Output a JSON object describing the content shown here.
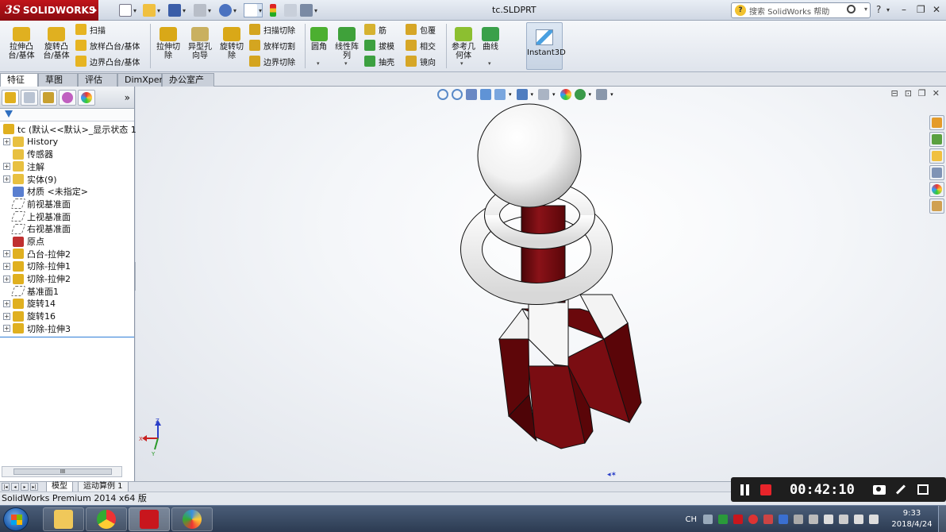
{
  "titlebar": {
    "logo_ds": "3S",
    "logo_text": "SOLIDWORKS",
    "doc_title": "tc.SLDPRT",
    "search_placeholder": "搜索 SolidWorks 帮助",
    "help": "?",
    "win_min": "–",
    "win_restore": "❐",
    "win_close": "✕"
  },
  "ribbon": {
    "big_buttons": [
      {
        "label": "拉伸凸\n台/基体",
        "icon": "extruded-boss-icon",
        "color": "#e0b020"
      },
      {
        "label": "旋转凸\n台/基体",
        "icon": "revolved-boss-icon",
        "color": "#e0b020"
      },
      {
        "label": "拉伸切\n除",
        "icon": "extruded-cut-icon",
        "color": "#d9a818"
      },
      {
        "label": "异型孔\n向导",
        "icon": "hole-wizard-icon",
        "color": "#c9b060"
      },
      {
        "label": "旋转切\n除",
        "icon": "revolved-cut-icon",
        "color": "#d9a818"
      },
      {
        "label": "圆角",
        "icon": "fillet-icon",
        "color": "#4caf30"
      },
      {
        "label": "线性阵\n列",
        "icon": "linear-pattern-icon",
        "color": "#3fa13a"
      },
      {
        "label": "参考几\n何体",
        "icon": "reference-geometry-icon",
        "color": "#8cbf30"
      },
      {
        "label": "曲线",
        "icon": "curves-icon",
        "color": "#3aa04a"
      }
    ],
    "small_buttons": [
      {
        "label": "扫描",
        "icon": "sweep-icon",
        "color": "#e6b422"
      },
      {
        "label": "放样凸台/基体",
        "icon": "loft-icon",
        "color": "#e6b422"
      },
      {
        "label": "边界凸台/基体",
        "icon": "boundary-boss-icon",
        "color": "#e6b422"
      },
      {
        "label": "扫描切除",
        "icon": "swept-cut-icon",
        "color": "#d4a520"
      },
      {
        "label": "放样切割",
        "icon": "lofted-cut-icon",
        "color": "#d4a520"
      },
      {
        "label": "边界切除",
        "icon": "boundary-cut-icon",
        "color": "#d4a520"
      },
      {
        "label": "筋",
        "icon": "rib-icon",
        "color": "#d6b230"
      },
      {
        "label": "拔模",
        "icon": "draft-icon",
        "color": "#3ca040"
      },
      {
        "label": "抽壳",
        "icon": "shell-icon",
        "color": "#3ca040"
      },
      {
        "label": "包覆",
        "icon": "wrap-icon",
        "color": "#d6a626"
      },
      {
        "label": "相交",
        "icon": "intersect-icon",
        "color": "#d6a626"
      },
      {
        "label": "镜向",
        "icon": "mirror-icon",
        "color": "#d6a626"
      }
    ],
    "instant3d": "Instant3D"
  },
  "tabs": [
    "特征",
    "草图",
    "评估",
    "DimXpert",
    "办公室产品"
  ],
  "tree": {
    "root": "tc  (默认<<默认>_显示状态 1>",
    "items": [
      {
        "label": "History",
        "icon": "history-icon",
        "expand": "+",
        "color": "#e8c040"
      },
      {
        "label": "传感器",
        "icon": "sensor-icon",
        "expand": "",
        "color": "#e8c040"
      },
      {
        "label": "注解",
        "icon": "annotations-icon",
        "expand": "+",
        "color": "#e8c040"
      },
      {
        "label": "实体(9)",
        "icon": "solid-bodies-icon",
        "expand": "+",
        "color": "#e8c040"
      },
      {
        "label": "材质 <未指定>",
        "icon": "material-icon",
        "expand": "",
        "color": "#5a7fd0"
      },
      {
        "label": "前视基准面",
        "icon": "plane-icon",
        "expand": "",
        "color": "plane"
      },
      {
        "label": "上视基准面",
        "icon": "plane-icon",
        "expand": "",
        "color": "plane"
      },
      {
        "label": "右视基准面",
        "icon": "plane-icon",
        "expand": "",
        "color": "plane"
      },
      {
        "label": "原点",
        "icon": "origin-icon",
        "expand": "",
        "color": "#c03030"
      },
      {
        "label": "凸台-拉伸2",
        "icon": "boss-extrude-icon",
        "expand": "+",
        "color": "#e0b020"
      },
      {
        "label": "切除-拉伸1",
        "icon": "cut-extrude-icon",
        "expand": "+",
        "color": "#e0b020"
      },
      {
        "label": "切除-拉伸2",
        "icon": "cut-extrude-icon",
        "expand": "+",
        "color": "#e0b020"
      },
      {
        "label": "基准面1",
        "icon": "plane-icon",
        "expand": "",
        "color": "plane"
      },
      {
        "label": "旋转14",
        "icon": "revolve-icon",
        "expand": "+",
        "color": "#e0b020"
      },
      {
        "label": "旋转16",
        "icon": "revolve-icon",
        "expand": "+",
        "color": "#e0b020"
      },
      {
        "label": "切除-拉伸3",
        "icon": "cut-extrude-icon",
        "expand": "+",
        "color": "#e0b020"
      }
    ]
  },
  "bottom_tabs": [
    "模型",
    "运动算例 1"
  ],
  "status": "SolidWorks Premium 2014 x64 版",
  "recorder": {
    "time": "00:42:10"
  },
  "triad": {
    "x": "X",
    "y": "Y",
    "z": "Z"
  },
  "taskbar": {
    "lang": "CH",
    "time": "9:33",
    "date": "2018/4/24"
  },
  "colors": {
    "shaft": "#7a0d12",
    "shaft_dark": "#5a0609",
    "white_part": "#f5f5f5"
  }
}
